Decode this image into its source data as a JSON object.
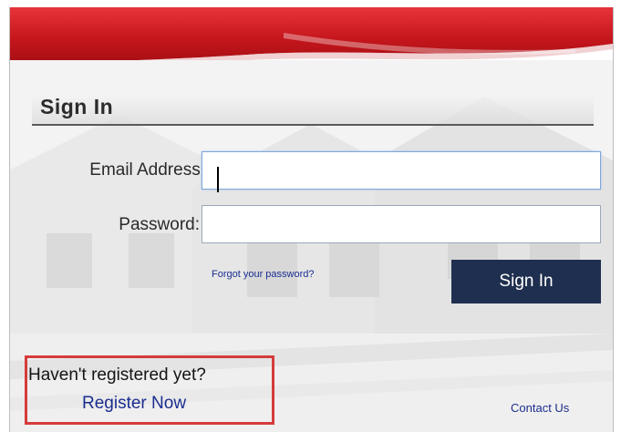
{
  "form": {
    "title": "Sign In",
    "email_label": "Email Address:",
    "email_value": "",
    "password_label": "Password:",
    "password_value": "",
    "forgot_link": "Forgot your password?",
    "signin_button": "Sign In"
  },
  "register": {
    "prompt": "Haven't registered yet?",
    "link": "Register Now",
    "highlight_color": "#d63b3b"
  },
  "footer": {
    "contact_link": "Contact Us"
  },
  "colors": {
    "header_red": "#c4161c",
    "button_navy": "#1f2f4f",
    "link_blue": "#1a2d8f"
  }
}
